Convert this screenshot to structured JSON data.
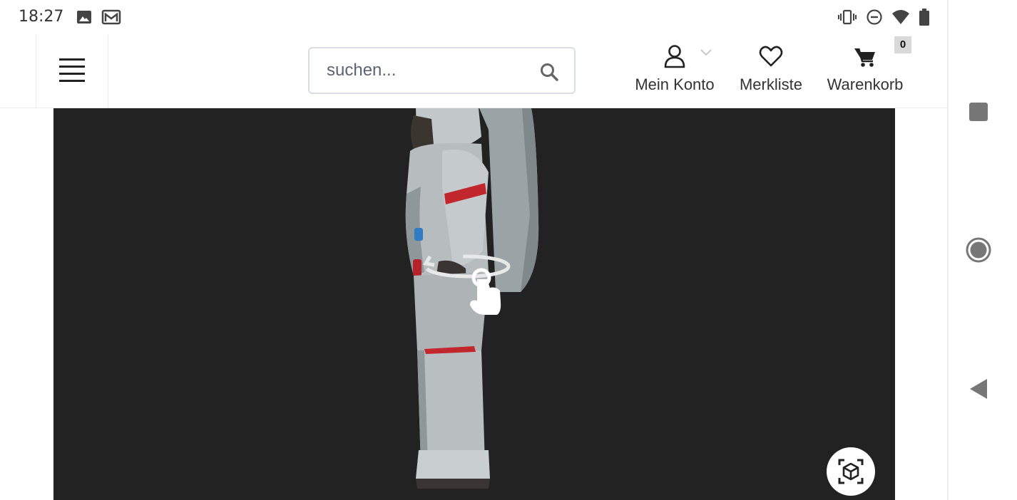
{
  "status_bar": {
    "time": "18:27",
    "left_icons": [
      "image-icon",
      "gmail-icon"
    ],
    "right_icons": [
      "vibrate-icon",
      "do-not-disturb-icon",
      "wifi-icon",
      "battery-icon"
    ]
  },
  "header": {
    "menu_icon": "hamburger-menu-icon",
    "search": {
      "placeholder": "suchen...",
      "value": "",
      "icon": "search-icon"
    },
    "account": {
      "label": "Mein Konto",
      "icon": "user-icon",
      "dropdown_icon": "chevron-down-icon"
    },
    "wishlist": {
      "label": "Merkliste",
      "icon": "heart-icon"
    },
    "cart": {
      "label": "Warenkorb",
      "icon": "cart-icon",
      "count": "0"
    }
  },
  "viewer": {
    "background": "#222222",
    "gesture_hint_icon": "rotate-gesture-icon",
    "ar_button_icon": "ar-cube-icon"
  },
  "nav_bar": {
    "buttons": [
      "recents-square-icon",
      "home-circle-icon",
      "back-triangle-icon"
    ]
  }
}
